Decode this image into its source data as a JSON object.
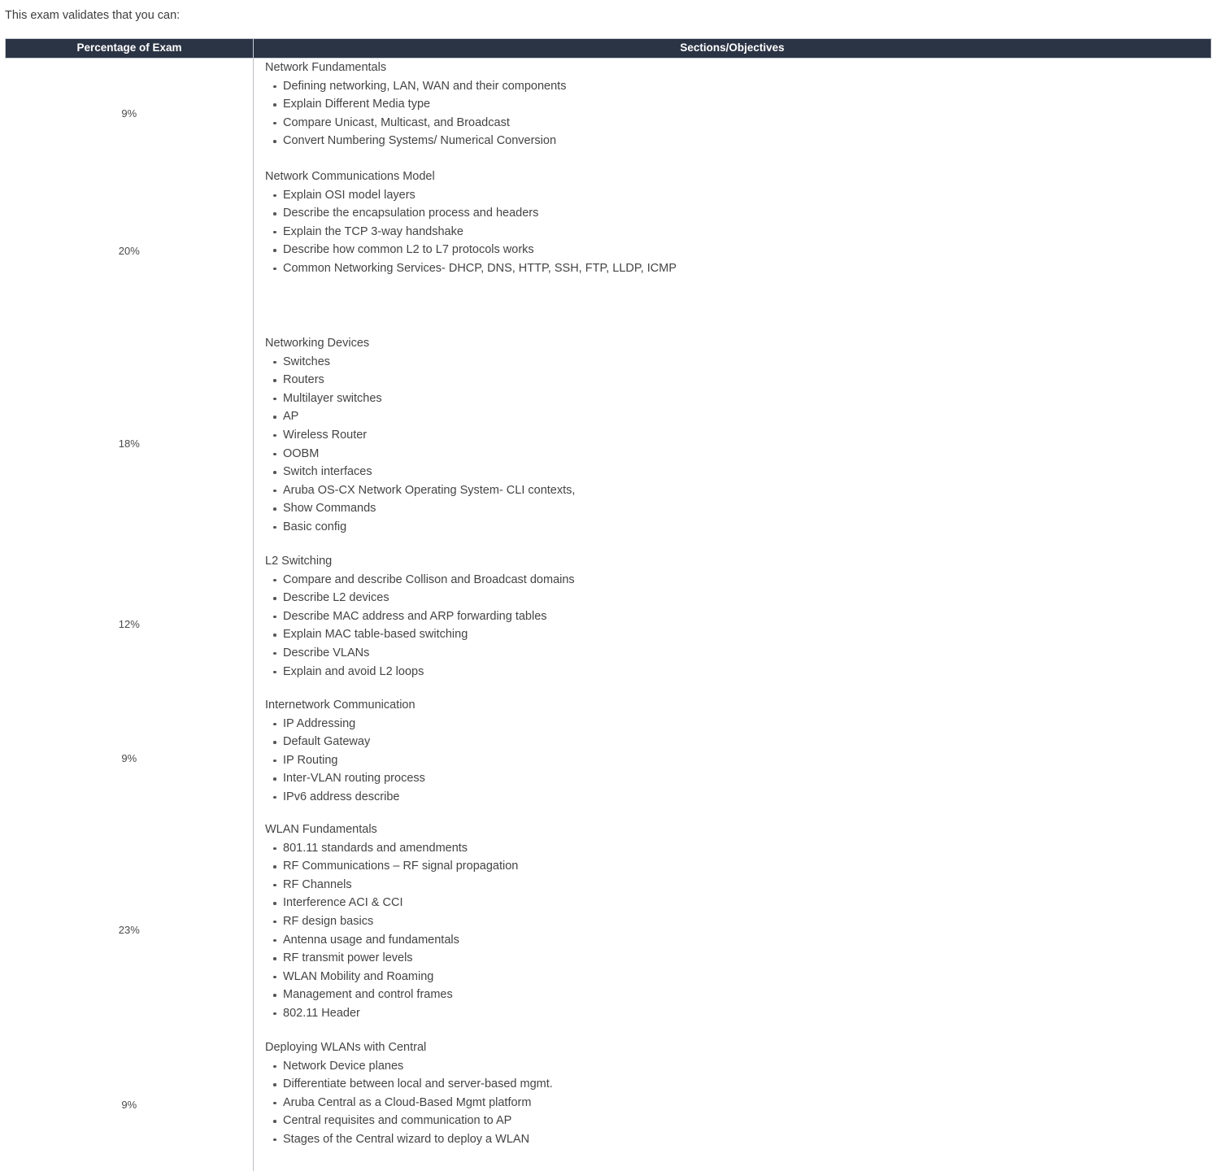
{
  "intro": "This exam validates that you can:",
  "table": {
    "headers": {
      "percentage": "Percentage of Exam",
      "objectives": "Sections/Objectives"
    },
    "accent_header_bg": "#2b3444",
    "header_text_color": "#ffffff",
    "body_text_color": "#444444",
    "divider_color": "#b9bfc7",
    "rows": [
      {
        "percentage": "9%",
        "section_title": "Network Fundamentals",
        "items": [
          "Defining networking, LAN, WAN and their components",
          "Explain Different Media type",
          "Compare Unicast, Multicast, and Broadcast",
          "Convert Numbering Systems/ Numerical Conversion"
        ]
      },
      {
        "percentage": "20%",
        "section_title": "Network Communications Model",
        "items": [
          "Explain OSI model layers",
          "Describe the encapsulation process and headers",
          "Explain the TCP 3-way handshake",
          "Describe how common L2 to L7 protocols works",
          "Common Networking Services- DHCP, DNS, HTTP, SSH, FTP, LLDP, ICMP"
        ]
      },
      {
        "percentage": "18%",
        "section_title": "Networking Devices",
        "items": [
          "Switches",
          "Routers",
          "Multilayer switches",
          "AP",
          "Wireless Router",
          "OOBM",
          "Switch interfaces",
          "Aruba OS-CX Network Operating System- CLI contexts,",
          "Show Commands",
          "Basic config"
        ]
      },
      {
        "percentage": "12%",
        "section_title": "L2 Switching",
        "items": [
          "Compare and describe Collison and Broadcast domains",
          "Describe L2 devices",
          "Describe MAC address and ARP forwarding tables",
          "Explain MAC table-based switching",
          "Describe VLANs",
          "Explain and avoid L2 loops"
        ]
      },
      {
        "percentage": "9%",
        "section_title": "Internetwork Communication",
        "items": [
          "IP Addressing",
          "Default Gateway",
          "IP Routing",
          "Inter-VLAN routing process",
          "IPv6 address describe"
        ]
      },
      {
        "percentage": "23%",
        "section_title": "WLAN Fundamentals",
        "items": [
          "801.11 standards and amendments",
          "RF Communications – RF signal propagation",
          "RF Channels",
          "Interference ACI & CCI",
          "RF design basics",
          "Antenna usage and fundamentals",
          "RF transmit power levels",
          "WLAN Mobility and Roaming",
          "Management and control frames",
          "802.11 Header"
        ]
      },
      {
        "percentage": "9%",
        "section_title": "Deploying WLANs with Central",
        "items": [
          "Network Device planes",
          "Differentiate between local and server-based mgmt.",
          "Aruba Central as a Cloud-Based Mgmt platform",
          "Central requisites and communication to AP",
          "Stages of the Central wizard to deploy a WLAN"
        ]
      }
    ]
  }
}
